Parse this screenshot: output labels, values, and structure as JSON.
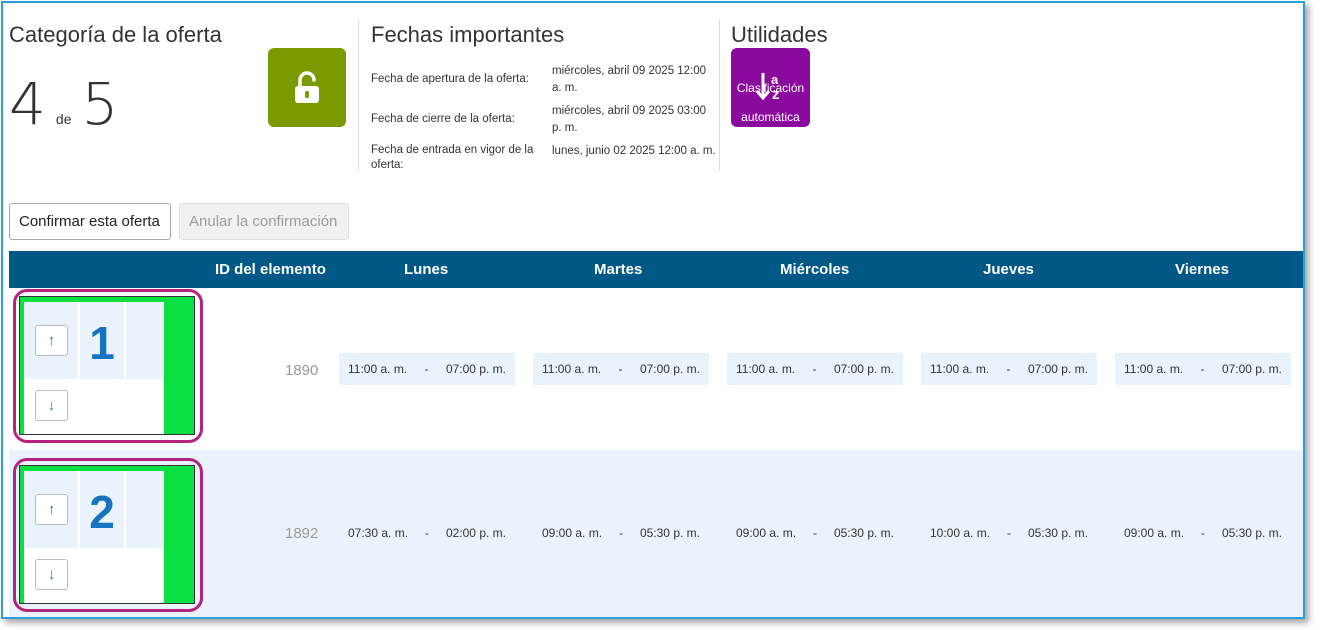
{
  "category": {
    "title": "Categoría de la oferta",
    "current": "4",
    "of_label": "de",
    "total": "5"
  },
  "dates": {
    "title": "Fechas importantes",
    "rows": [
      {
        "label": "Fecha de apertura de la oferta:",
        "value": "miércoles, abril 09 2025 12:00 a. m."
      },
      {
        "label": "Fecha de cierre de la oferta:",
        "value": "miércoles, abril 09 2025 03:00 p. m."
      },
      {
        "label": "Fecha de entrada en vigor de la oferta:",
        "value": "lunes, junio 02 2025 12:00 a. m."
      }
    ]
  },
  "utilities": {
    "title": "Utilidades",
    "auto_sort_line1": "Clasificación",
    "auto_sort_line2": "automática"
  },
  "actions": {
    "confirm": "Confirmar esta oferta",
    "cancel": "Anular la confirmación"
  },
  "table": {
    "headers": [
      "ID del elemento",
      "Lunes",
      "Martes",
      "Miércoles",
      "Jueves",
      "Viernes"
    ],
    "separator": "-",
    "rows": [
      {
        "rank": "1",
        "id": "1890",
        "days": [
          {
            "start": "11:00 a. m.",
            "end": "07:00 p. m."
          },
          {
            "start": "11:00 a. m.",
            "end": "07:00 p. m."
          },
          {
            "start": "11:00 a. m.",
            "end": "07:00 p. m."
          },
          {
            "start": "11:00 a. m.",
            "end": "07:00 p. m."
          },
          {
            "start": "11:00 a. m.",
            "end": "07:00 p. m."
          }
        ]
      },
      {
        "rank": "2",
        "id": "1892",
        "days": [
          {
            "start": "07:30 a. m.",
            "end": "02:00 p. m."
          },
          {
            "start": "09:00 a. m.",
            "end": "05:30 p. m."
          },
          {
            "start": "09:00 a. m.",
            "end": "05:30 p. m."
          },
          {
            "start": "10:00 a. m.",
            "end": "05:30 p. m."
          },
          {
            "start": "09:00 a. m.",
            "end": "05:30 p. m."
          }
        ]
      }
    ]
  },
  "icons": {
    "lock": "unlock-icon",
    "sort": "sort-icon",
    "up": "arrow-up-icon",
    "down": "arrow-down-icon"
  },
  "colors": {
    "header_bg": "#005887",
    "lock_button": "#7a9b00",
    "utility_button": "#8b0a9e",
    "rank_green": "#0ae042",
    "highlight": "#b4237d",
    "rank_number": "#1573c0"
  }
}
